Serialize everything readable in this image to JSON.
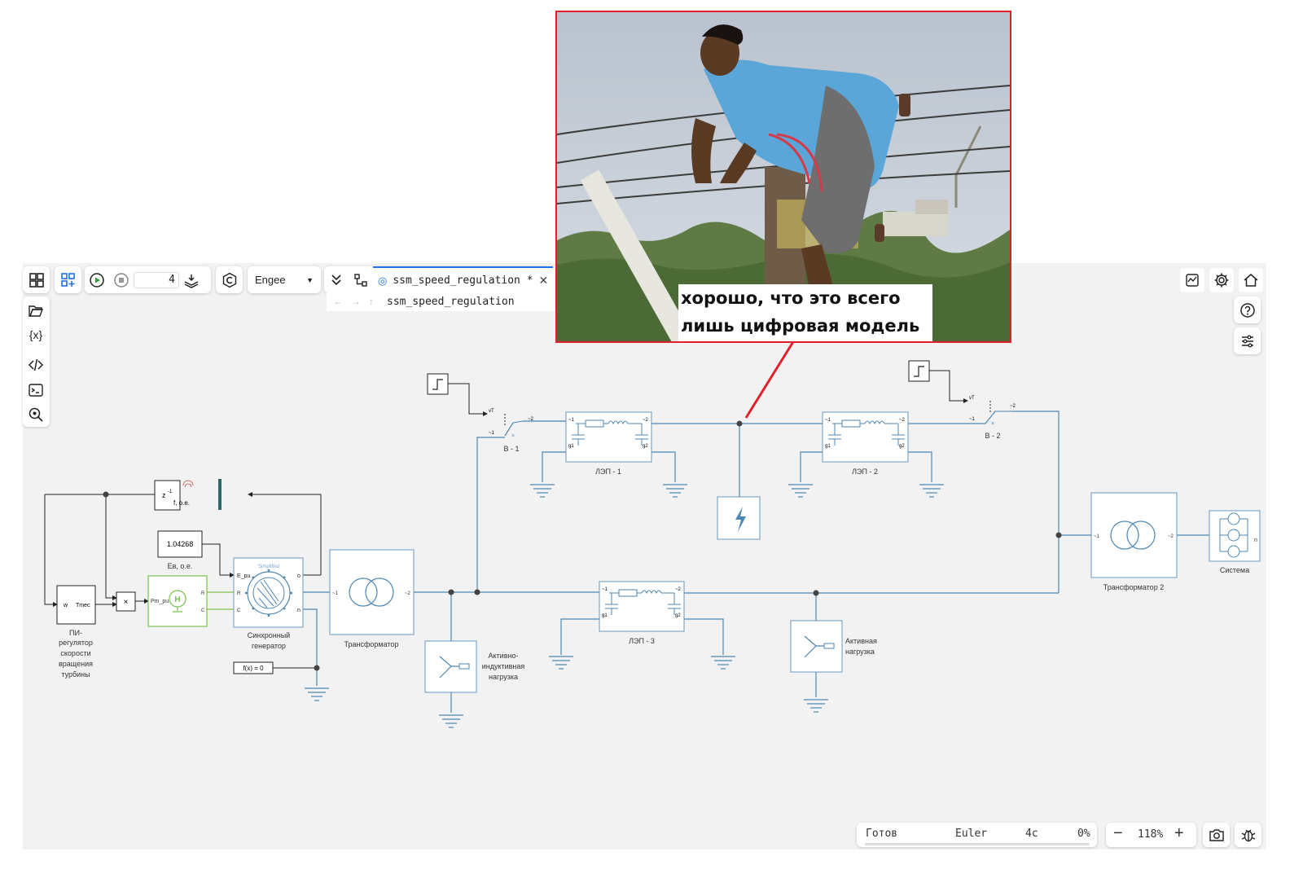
{
  "toolbar": {
    "step_value": "4",
    "engine_select": "Engee",
    "tab_title": "ssm_speed_regulation *",
    "breadcrumb": "ssm_speed_regulation"
  },
  "meme": {
    "caption_line1": "хорошо, что это всего",
    "caption_line2": "лишь цифровая модель"
  },
  "blocks": {
    "pi_w": "w",
    "pi_tmec": "Tmec",
    "pi_label": [
      "ПИ-",
      "регулятор",
      "скорости",
      "вращения",
      "турбины"
    ],
    "product": "×",
    "pm_pu": "Pm_pu",
    "delay_z": "z",
    "delay_exp": "-1",
    "delay_f": "f, o.e.",
    "const_value": "1.04268",
    "const_label": "Ев, о.е.",
    "gen_header": "Simplified",
    "gen_epu": "E_pu",
    "gen_r": "R",
    "gen_c": "C",
    "gen_o": "o",
    "gen_n": "n",
    "gen_label": [
      "Синхронный",
      "генератор"
    ],
    "fx": "f(x) = 0",
    "transformer_label": "Трансформатор",
    "port1": "~1",
    "port2": "~2",
    "vt": "vT",
    "g1": "g1",
    "g2": "g2",
    "b1_label": "В - 1",
    "b2_label": "В - 2",
    "lep1_label": "ЛЭП - 1",
    "lep2_label": "ЛЭП - 2",
    "lep3_label": "ЛЭП - 3",
    "ri_load_label": [
      "Активно-",
      "индуктивная",
      "нагрузка"
    ],
    "a_load_label": [
      "Активная",
      "нагрузка"
    ],
    "transformer2_label": "Трансформатор 2",
    "system_label": "Система",
    "system_n": "n"
  },
  "status": {
    "state": "Готов",
    "solver": "Euler",
    "time": "4с",
    "progress": "0%",
    "zoom": "118%"
  },
  "colors": {
    "wire": "#4d87b3",
    "block_border": "#6a98c0",
    "signal": "#222222",
    "green": "#7bc24f",
    "bus": "#2a6a6a",
    "meme_border": "#e0212b"
  }
}
